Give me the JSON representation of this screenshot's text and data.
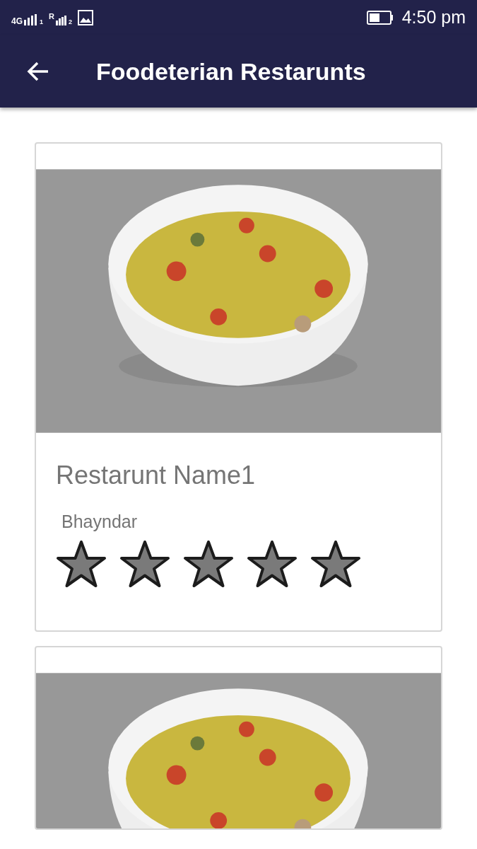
{
  "status_bar": {
    "network_1": "4G",
    "sim_1": "1",
    "network_2": "R",
    "sim_2": "2",
    "time": "4:50 pm"
  },
  "app_bar": {
    "title": "Foodeterian Restarunts"
  },
  "restaurants": [
    {
      "kind": "full",
      "name": "Restarunt Name1",
      "location": "Bhayndar",
      "stars": 5
    },
    {
      "kind": "image_only"
    }
  ]
}
